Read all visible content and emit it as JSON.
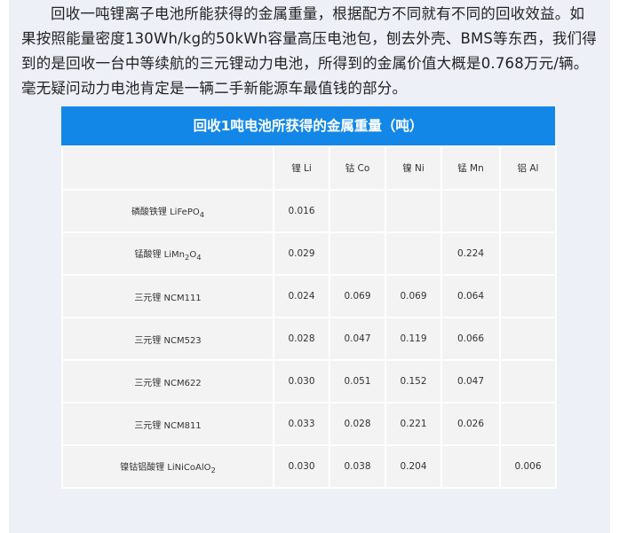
{
  "paragraph": "回收一吨锂离子电池所能获得的金属重量，根据配方不同就有不同的回收效益。如果按照能量密度130Wh/kg的50kWh容量高压电池包，刨去外壳、BMS等东西，我们得到的是回收一台中等续航的三元锂动力电池，所得到的金属价值大概是0.768万元/辆。毫无疑问动力电池肯定是一辆二手新能源车最值钱的部分。",
  "table": {
    "title": "回收1吨电池所获得的金属重量（吨）",
    "headers": [
      "",
      "锂 Li",
      "钴 Co",
      "镍 Ni",
      "锰 Mn",
      "铝 Al"
    ],
    "rows": [
      {
        "name": "磷酸铁锂 LiFePO",
        "sub": "4",
        "li": "0.016",
        "co": "",
        "ni": "",
        "mn": "",
        "al": ""
      },
      {
        "name": "锰酸锂 LiMn",
        "sub": "2",
        "name2": "O",
        "sub2": "4",
        "li": "0.029",
        "co": "",
        "ni": "",
        "mn": "0.224",
        "al": ""
      },
      {
        "name": "三元锂 NCM111",
        "li": "0.024",
        "co": "0.069",
        "ni": "0.069",
        "mn": "0.064",
        "al": ""
      },
      {
        "name": "三元锂 NCM523",
        "li": "0.028",
        "co": "0.047",
        "ni": "0.119",
        "mn": "0.066",
        "al": ""
      },
      {
        "name": "三元锂 NCM622",
        "li": "0.030",
        "co": "0.051",
        "ni": "0.152",
        "mn": "0.047",
        "al": ""
      },
      {
        "name": "三元锂 NCM811",
        "li": "0.033",
        "co": "0.028",
        "ni": "0.221",
        "mn": "0.026",
        "al": ""
      },
      {
        "name": "镍钴铝酸锂 LiNiCoAlO",
        "sub": "2",
        "li": "0.030",
        "co": "0.038",
        "ni": "0.204",
        "mn": "",
        "al": "0.006"
      }
    ]
  }
}
